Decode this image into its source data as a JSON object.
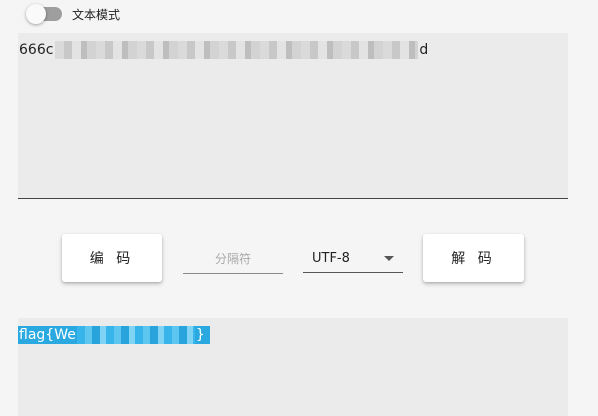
{
  "toggle": {
    "label": "文本模式",
    "checked": false
  },
  "input": {
    "value_prefix": "666c",
    "value_suffix": "d",
    "value_redacted": true
  },
  "controls": {
    "encode_label": "编 码",
    "separator_placeholder": "分隔符",
    "separator_value": "",
    "encoding_selected": "UTF-8",
    "decode_label": "解 码"
  },
  "output": {
    "value_prefix": "flag{We",
    "value_suffix": "}",
    "value_redacted": true,
    "selection_color": "#2aa8e0"
  },
  "colors": {
    "background": "#f5f5f5",
    "field_background": "#ebebeb",
    "selection": "#2aa8e0"
  },
  "icons": {
    "dropdown": "chevron-down-icon"
  }
}
